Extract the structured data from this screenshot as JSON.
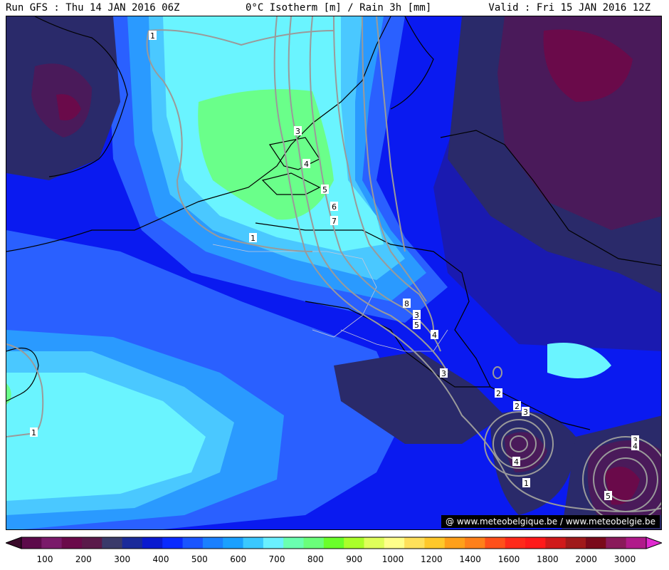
{
  "header": {
    "run": "Run GFS : Thu 14 JAN 2016 06Z",
    "product": "0°C Isotherm [m] / Rain 3h [mm]",
    "valid": "Valid : Fri 15 JAN 2016 12Z"
  },
  "credit": "@ www.meteobelgique.be / www.meteobelgie.be",
  "legend": {
    "ticks": [
      "100",
      "200",
      "300",
      "400",
      "500",
      "600",
      "700",
      "800",
      "900",
      "1000",
      "1200",
      "1400",
      "1600",
      "1800",
      "2000",
      "3000"
    ],
    "colors": [
      "#3a0a2a",
      "#5c0a4a",
      "#7a1a6a",
      "#6a0a4a",
      "#5a1a4a",
      "#3a3a6a",
      "#1a2a9a",
      "#0a1ad0",
      "#0a2aff",
      "#1a55ff",
      "#1a80ff",
      "#1aa0ff",
      "#3ac8ff",
      "#6af0ff",
      "#6affb0",
      "#6aff7a",
      "#6aff2a",
      "#aaff2a",
      "#dfff5a",
      "#ffff8a",
      "#ffe05a",
      "#ffc82a",
      "#ffa01a",
      "#ff801a",
      "#ff501a",
      "#ff2a1a",
      "#ff1a1a",
      "#d01a1a",
      "#a01a1a",
      "#7a0a1a",
      "#8a1a5a",
      "#b01a8a",
      "#e02ad0"
    ]
  },
  "rain_contour_labels": [
    "1",
    "1",
    "1",
    "1",
    "1",
    "2",
    "2",
    "3",
    "3",
    "3",
    "3",
    "3",
    "4",
    "4",
    "4",
    "4",
    "5",
    "5",
    "5",
    "6",
    "7",
    "8"
  ],
  "field_colors": {
    "deep_purple": "#3a1a4a",
    "dark_navy": "#2a2a6a",
    "navy": "#1a1ab0",
    "blue": "#0a1af0",
    "mid_blue": "#2a60ff",
    "sky_blue": "#2a9aff",
    "light_blue": "#4ac8ff",
    "cyan": "#6af4ff",
    "green": "#6aff8a"
  }
}
